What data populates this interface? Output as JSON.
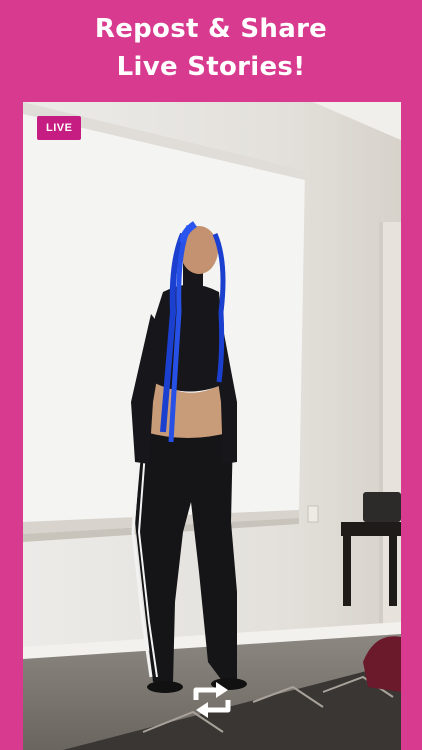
{
  "header": {
    "line1": "Repost & Share",
    "line2": "Live Stories!"
  },
  "story": {
    "badge": "LIVE"
  },
  "controls": {
    "repost_icon": "repost-icon"
  },
  "colors": {
    "background": "#d73a8f",
    "badge": "#c51d82",
    "text": "#ffffff"
  }
}
